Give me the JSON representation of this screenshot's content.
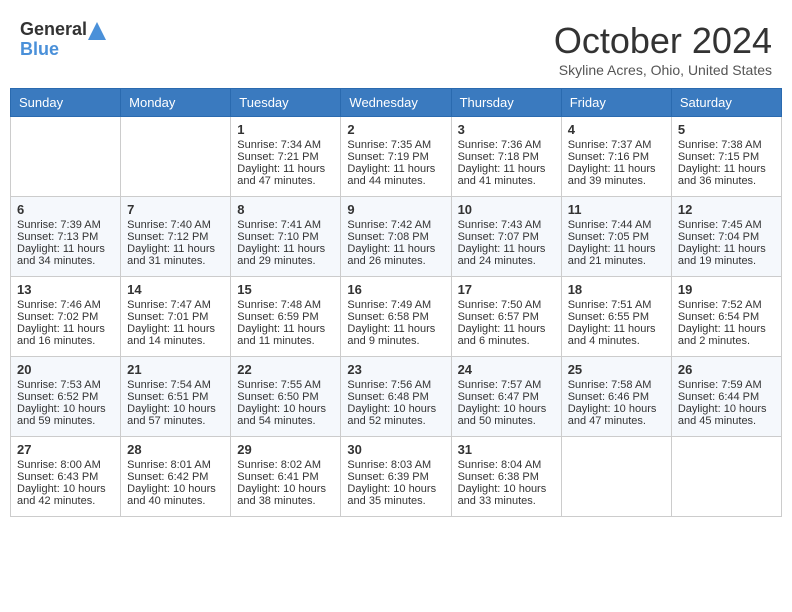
{
  "header": {
    "logo_general": "General",
    "logo_blue": "Blue",
    "month": "October 2024",
    "location": "Skyline Acres, Ohio, United States"
  },
  "days_of_week": [
    "Sunday",
    "Monday",
    "Tuesday",
    "Wednesday",
    "Thursday",
    "Friday",
    "Saturday"
  ],
  "weeks": [
    [
      {
        "day": "",
        "sunrise": "",
        "sunset": "",
        "daylight": ""
      },
      {
        "day": "",
        "sunrise": "",
        "sunset": "",
        "daylight": ""
      },
      {
        "day": "1",
        "sunrise": "Sunrise: 7:34 AM",
        "sunset": "Sunset: 7:21 PM",
        "daylight": "Daylight: 11 hours and 47 minutes."
      },
      {
        "day": "2",
        "sunrise": "Sunrise: 7:35 AM",
        "sunset": "Sunset: 7:19 PM",
        "daylight": "Daylight: 11 hours and 44 minutes."
      },
      {
        "day": "3",
        "sunrise": "Sunrise: 7:36 AM",
        "sunset": "Sunset: 7:18 PM",
        "daylight": "Daylight: 11 hours and 41 minutes."
      },
      {
        "day": "4",
        "sunrise": "Sunrise: 7:37 AM",
        "sunset": "Sunset: 7:16 PM",
        "daylight": "Daylight: 11 hours and 39 minutes."
      },
      {
        "day": "5",
        "sunrise": "Sunrise: 7:38 AM",
        "sunset": "Sunset: 7:15 PM",
        "daylight": "Daylight: 11 hours and 36 minutes."
      }
    ],
    [
      {
        "day": "6",
        "sunrise": "Sunrise: 7:39 AM",
        "sunset": "Sunset: 7:13 PM",
        "daylight": "Daylight: 11 hours and 34 minutes."
      },
      {
        "day": "7",
        "sunrise": "Sunrise: 7:40 AM",
        "sunset": "Sunset: 7:12 PM",
        "daylight": "Daylight: 11 hours and 31 minutes."
      },
      {
        "day": "8",
        "sunrise": "Sunrise: 7:41 AM",
        "sunset": "Sunset: 7:10 PM",
        "daylight": "Daylight: 11 hours and 29 minutes."
      },
      {
        "day": "9",
        "sunrise": "Sunrise: 7:42 AM",
        "sunset": "Sunset: 7:08 PM",
        "daylight": "Daylight: 11 hours and 26 minutes."
      },
      {
        "day": "10",
        "sunrise": "Sunrise: 7:43 AM",
        "sunset": "Sunset: 7:07 PM",
        "daylight": "Daylight: 11 hours and 24 minutes."
      },
      {
        "day": "11",
        "sunrise": "Sunrise: 7:44 AM",
        "sunset": "Sunset: 7:05 PM",
        "daylight": "Daylight: 11 hours and 21 minutes."
      },
      {
        "day": "12",
        "sunrise": "Sunrise: 7:45 AM",
        "sunset": "Sunset: 7:04 PM",
        "daylight": "Daylight: 11 hours and 19 minutes."
      }
    ],
    [
      {
        "day": "13",
        "sunrise": "Sunrise: 7:46 AM",
        "sunset": "Sunset: 7:02 PM",
        "daylight": "Daylight: 11 hours and 16 minutes."
      },
      {
        "day": "14",
        "sunrise": "Sunrise: 7:47 AM",
        "sunset": "Sunset: 7:01 PM",
        "daylight": "Daylight: 11 hours and 14 minutes."
      },
      {
        "day": "15",
        "sunrise": "Sunrise: 7:48 AM",
        "sunset": "Sunset: 6:59 PM",
        "daylight": "Daylight: 11 hours and 11 minutes."
      },
      {
        "day": "16",
        "sunrise": "Sunrise: 7:49 AM",
        "sunset": "Sunset: 6:58 PM",
        "daylight": "Daylight: 11 hours and 9 minutes."
      },
      {
        "day": "17",
        "sunrise": "Sunrise: 7:50 AM",
        "sunset": "Sunset: 6:57 PM",
        "daylight": "Daylight: 11 hours and 6 minutes."
      },
      {
        "day": "18",
        "sunrise": "Sunrise: 7:51 AM",
        "sunset": "Sunset: 6:55 PM",
        "daylight": "Daylight: 11 hours and 4 minutes."
      },
      {
        "day": "19",
        "sunrise": "Sunrise: 7:52 AM",
        "sunset": "Sunset: 6:54 PM",
        "daylight": "Daylight: 11 hours and 2 minutes."
      }
    ],
    [
      {
        "day": "20",
        "sunrise": "Sunrise: 7:53 AM",
        "sunset": "Sunset: 6:52 PM",
        "daylight": "Daylight: 10 hours and 59 minutes."
      },
      {
        "day": "21",
        "sunrise": "Sunrise: 7:54 AM",
        "sunset": "Sunset: 6:51 PM",
        "daylight": "Daylight: 10 hours and 57 minutes."
      },
      {
        "day": "22",
        "sunrise": "Sunrise: 7:55 AM",
        "sunset": "Sunset: 6:50 PM",
        "daylight": "Daylight: 10 hours and 54 minutes."
      },
      {
        "day": "23",
        "sunrise": "Sunrise: 7:56 AM",
        "sunset": "Sunset: 6:48 PM",
        "daylight": "Daylight: 10 hours and 52 minutes."
      },
      {
        "day": "24",
        "sunrise": "Sunrise: 7:57 AM",
        "sunset": "Sunset: 6:47 PM",
        "daylight": "Daylight: 10 hours and 50 minutes."
      },
      {
        "day": "25",
        "sunrise": "Sunrise: 7:58 AM",
        "sunset": "Sunset: 6:46 PM",
        "daylight": "Daylight: 10 hours and 47 minutes."
      },
      {
        "day": "26",
        "sunrise": "Sunrise: 7:59 AM",
        "sunset": "Sunset: 6:44 PM",
        "daylight": "Daylight: 10 hours and 45 minutes."
      }
    ],
    [
      {
        "day": "27",
        "sunrise": "Sunrise: 8:00 AM",
        "sunset": "Sunset: 6:43 PM",
        "daylight": "Daylight: 10 hours and 42 minutes."
      },
      {
        "day": "28",
        "sunrise": "Sunrise: 8:01 AM",
        "sunset": "Sunset: 6:42 PM",
        "daylight": "Daylight: 10 hours and 40 minutes."
      },
      {
        "day": "29",
        "sunrise": "Sunrise: 8:02 AM",
        "sunset": "Sunset: 6:41 PM",
        "daylight": "Daylight: 10 hours and 38 minutes."
      },
      {
        "day": "30",
        "sunrise": "Sunrise: 8:03 AM",
        "sunset": "Sunset: 6:39 PM",
        "daylight": "Daylight: 10 hours and 35 minutes."
      },
      {
        "day": "31",
        "sunrise": "Sunrise: 8:04 AM",
        "sunset": "Sunset: 6:38 PM",
        "daylight": "Daylight: 10 hours and 33 minutes."
      },
      {
        "day": "",
        "sunrise": "",
        "sunset": "",
        "daylight": ""
      },
      {
        "day": "",
        "sunrise": "",
        "sunset": "",
        "daylight": ""
      }
    ]
  ]
}
